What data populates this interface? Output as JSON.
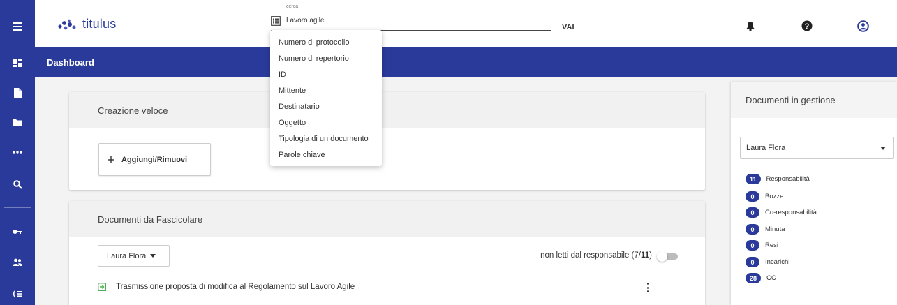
{
  "app": {
    "name": "titulus"
  },
  "search": {
    "label": "cerca",
    "value": "Lavoro agile",
    "submit_label": "VAI"
  },
  "search_options": [
    "Numero di protocollo",
    "Numero di repertorio",
    "ID",
    "Mittente",
    "Destinatario",
    "Oggetto",
    "Tipologia di un documento",
    "Parole chiave"
  ],
  "band": {
    "title": "Dashboard"
  },
  "quick_create": {
    "title": "Creazione veloce",
    "add_label": "Aggiungi/Rimuovi"
  },
  "documents": {
    "title": "Documenti da Fascicolare",
    "user_select": "Laura Flora",
    "unread_prefix": "non letti dal responsabile (7/",
    "unread_total": "11",
    "unread_suffix": ")",
    "rows": [
      {
        "title": "Trasmissione proposta di modifica al Regolamento sul Lavoro Agile"
      }
    ]
  },
  "managed": {
    "title": "Documenti in gestione",
    "user_select": "Laura Flora",
    "stats": [
      {
        "count": "11",
        "label": "Responsabilità"
      },
      {
        "count": "0",
        "label": "Bozze"
      },
      {
        "count": "0",
        "label": "Co-responsabilità"
      },
      {
        "count": "0",
        "label": "Minuta"
      },
      {
        "count": "0",
        "label": "Resi"
      },
      {
        "count": "0",
        "label": "Incarichi"
      },
      {
        "count": "28",
        "label": "CC"
      }
    ]
  },
  "rail_icons": [
    "menu-icon",
    "dashboard-icon",
    "document-icon",
    "folder-icon",
    "more-icon",
    "search-icon",
    "key-icon",
    "users-icon",
    "list-icon"
  ],
  "header_icons": [
    "bell-icon",
    "help-icon",
    "account-icon"
  ],
  "colors": {
    "brand": "#2a3a9a",
    "accent_green": "#4caf50"
  }
}
